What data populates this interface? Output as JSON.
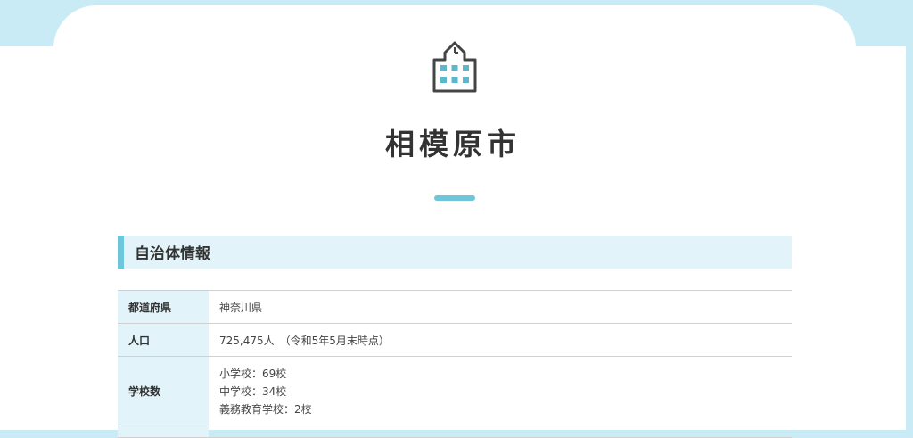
{
  "page": {
    "title": "相模原市",
    "icon": "school-building-icon"
  },
  "colors": {
    "accent": "#6ec6da",
    "background": "#c8ebf5",
    "heading_bg": "#e2f4fa"
  },
  "section": {
    "heading": "自治体情報"
  },
  "table": {
    "rows": [
      {
        "label": "都道府県",
        "value": "神奈川県"
      },
      {
        "label": "人口",
        "value": "725,475人　（令和5年5月末時点）"
      },
      {
        "label": "学校数",
        "lines": [
          "小学校：69校",
          "中学校：34校",
          "義務教育学校：2校"
        ]
      }
    ]
  }
}
